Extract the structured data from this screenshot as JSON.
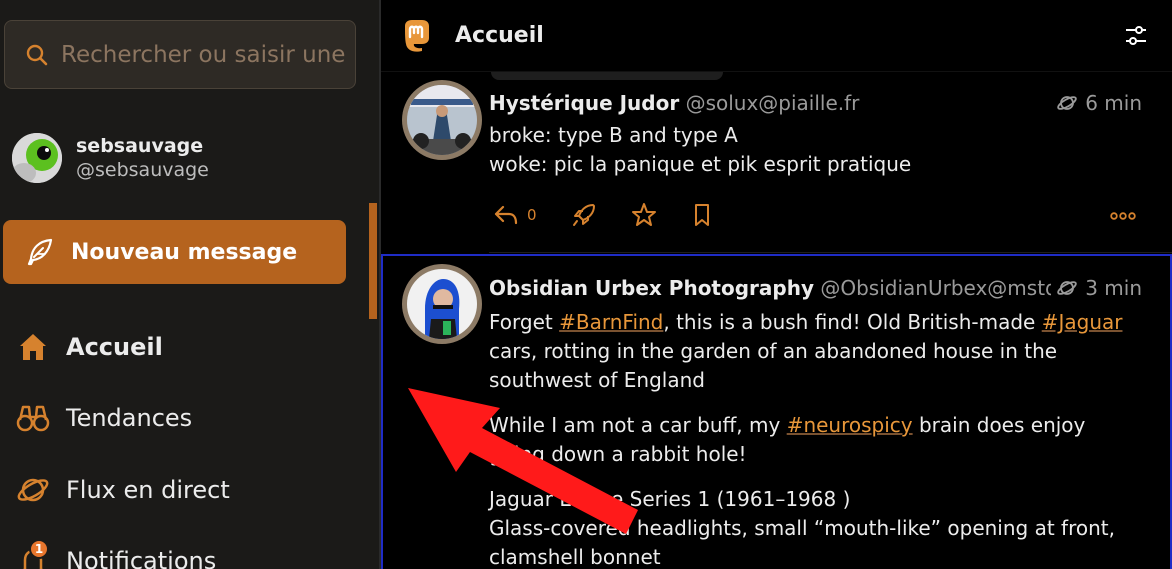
{
  "colors": {
    "accent": "#b5631e",
    "link": "#e8973a",
    "focus_border": "#1f2cc6",
    "annotation_arrow": "#ff1a1a"
  },
  "search": {
    "placeholder": "Rechercher ou saisir une",
    "icon": "search-icon"
  },
  "account": {
    "name": "sebsauvage",
    "handle": "@sebsauvage"
  },
  "compose": {
    "label": "Nouveau message",
    "icon": "quill-icon"
  },
  "nav": {
    "items": [
      {
        "label": "Accueil",
        "icon": "home-icon",
        "active": true
      },
      {
        "label": "Tendances",
        "icon": "binoculars-icon"
      },
      {
        "label": "Flux en direct",
        "icon": "planet-icon"
      },
      {
        "label": "Notifications",
        "icon": "bell-icon",
        "badge": "1"
      }
    ]
  },
  "header": {
    "title": "Accueil",
    "logo": "mastodon-logo-icon",
    "settings_icon": "sliders-icon"
  },
  "posts": [
    {
      "author": "Hystérique Judor",
      "handle": "@solux@piaille.fr",
      "time": "6 min",
      "lines": [
        "broke: type B and type A",
        "woke: pic la panique et pik esprit pratique"
      ],
      "reply_count": "0"
    },
    {
      "author": "Obsidian Urbex Photography",
      "handle": "@ObsidianUrbex@mstdn.s",
      "time": "3 min",
      "p1": {
        "t1": "Forget ",
        "tag1": "#BarnFind",
        "t2": ", this is a bush find! Old British-made ",
        "tag2": "#Jaguar",
        "t3": " cars, rotting in the garden of an abandoned house in the southwest of England"
      },
      "p2": {
        "t1": "While I am not a car buff, my ",
        "tag1": "#neurospicy",
        "t2": " brain does enjoy going down a rabbit hole!"
      },
      "p3": {
        "l1": "Jaguar E-Type Series 1 (1961–1968 )",
        "l2": "Glass-covered headlights, small “mouth-like” opening at front, clamshell bonnet"
      }
    }
  ]
}
